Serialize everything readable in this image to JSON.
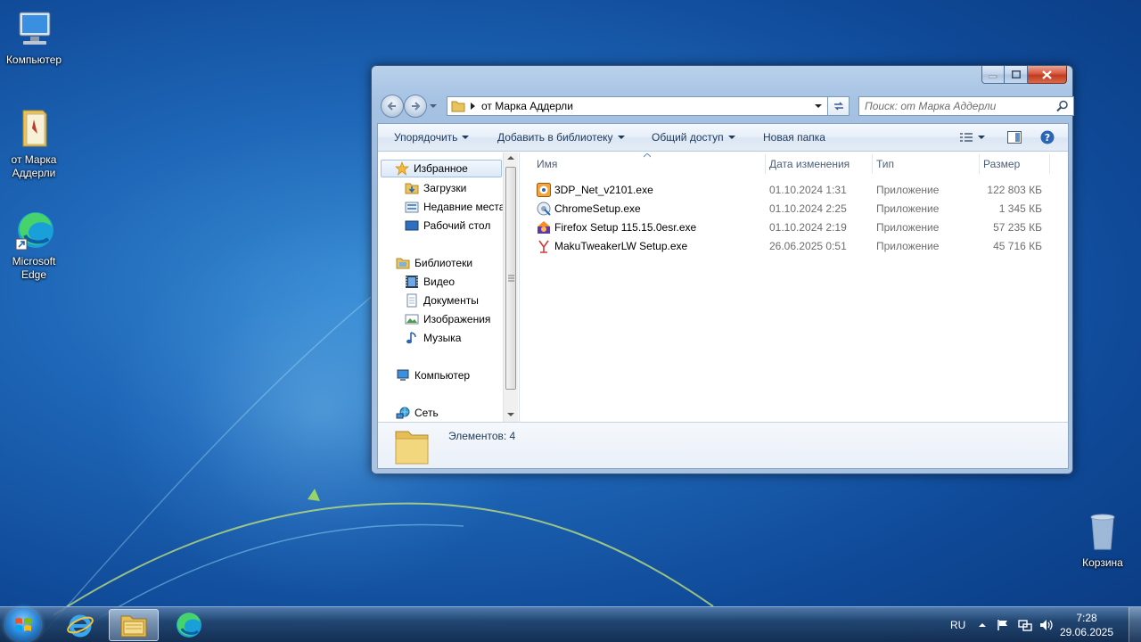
{
  "desktop": {
    "icons": [
      {
        "label": "Компьютер",
        "icon": "computer-icon"
      },
      {
        "label": "от Марка Аддерли",
        "icon": "folder-icon"
      },
      {
        "label": "Microsoft Edge",
        "icon": "edge-icon"
      },
      {
        "label": "Корзина",
        "icon": "recycle-bin-icon"
      }
    ]
  },
  "window": {
    "address": {
      "folder": "от Марка Аддерли"
    },
    "search": {
      "placeholder": "Поиск: от Марка Аддерли"
    },
    "toolbar": {
      "organize": "Упорядочить",
      "add_to_library": "Добавить в библиотеку",
      "share": "Общий доступ",
      "new_folder": "Новая папка"
    },
    "nav": {
      "favorites": "Избранное",
      "downloads": "Загрузки",
      "recent": "Недавние места",
      "desktop": "Рабочий стол",
      "libraries": "Библиотеки",
      "video": "Видео",
      "documents": "Документы",
      "images": "Изображения",
      "music": "Музыка",
      "computer": "Компьютер",
      "network": "Сеть"
    },
    "columns": {
      "name": "Имя",
      "date": "Дата изменения",
      "type": "Тип",
      "size": "Размер"
    },
    "files": [
      {
        "name": "3DP_Net_v2101.exe",
        "date": "01.10.2024 1:31",
        "type": "Приложение",
        "size": "122 803 КБ",
        "icon": "3dp-net-icon"
      },
      {
        "name": "ChromeSetup.exe",
        "date": "01.10.2024 2:25",
        "type": "Приложение",
        "size": "1 345 КБ",
        "icon": "installer-icon"
      },
      {
        "name": "Firefox Setup 115.15.0esr.exe",
        "date": "01.10.2024 2:19",
        "type": "Приложение",
        "size": "57 235 КБ",
        "icon": "firefox-setup-icon"
      },
      {
        "name": "MakuTweakerLW Setup.exe",
        "date": "26.06.2025 0:51",
        "type": "Приложение",
        "size": "45 716 КБ",
        "icon": "makutweaker-icon"
      }
    ],
    "status": {
      "items_count": "Элементов: 4"
    }
  },
  "taskbar": {
    "language": "RU",
    "time": "7:28",
    "date": "29.06.2025"
  },
  "colors": {
    "accent": "#1e395b",
    "close": "#c23a1f"
  }
}
